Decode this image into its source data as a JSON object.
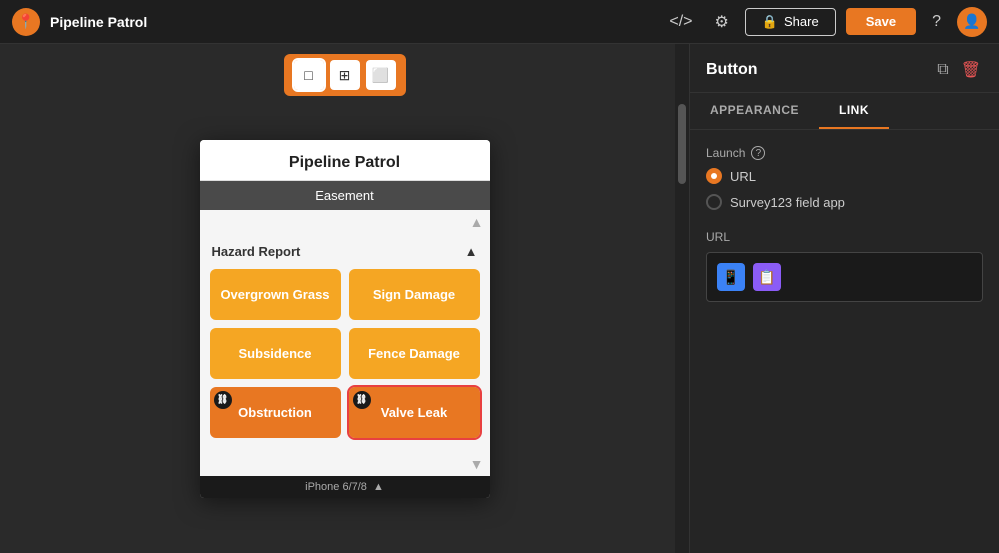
{
  "app": {
    "logo_icon": "📍",
    "title": "Pipeline Patrol",
    "share_label": "Share",
    "save_label": "Save",
    "help_icon": "?",
    "avatar_icon": "👤"
  },
  "device_toolbar": {
    "icon1": "□",
    "icon2": "⊞",
    "icon3": "⬜"
  },
  "phone": {
    "title": "Pipeline Patrol",
    "section": "Easement",
    "hazard_report": "Hazard Report",
    "buttons": [
      {
        "label": "Overgrown Grass",
        "style": "light-orange",
        "linked": false
      },
      {
        "label": "Sign Damage",
        "style": "light-orange",
        "linked": false
      },
      {
        "label": "Subsidence",
        "style": "light-orange",
        "linked": false
      },
      {
        "label": "Fence Damage",
        "style": "light-orange",
        "linked": false
      },
      {
        "label": "Obstruction",
        "style": "orange",
        "linked": true
      },
      {
        "label": "Valve Leak",
        "style": "orange",
        "linked": true,
        "selected": true
      }
    ],
    "footer": "iPhone 6/7/8"
  },
  "right_panel": {
    "title": "Button",
    "tabs": [
      "APPEARANCE",
      "LINK"
    ],
    "active_tab": "LINK",
    "launch_label": "Launch",
    "launch_options": [
      {
        "label": "URL",
        "selected": true
      },
      {
        "label": "Survey123 field app",
        "selected": false
      }
    ],
    "url_label": "URL",
    "url_chips": [
      {
        "type": "mobile-icon",
        "color": "blue"
      },
      {
        "type": "survey-icon",
        "color": "purple"
      }
    ],
    "copy_icon": "⧉",
    "delete_icon": "🗑"
  }
}
